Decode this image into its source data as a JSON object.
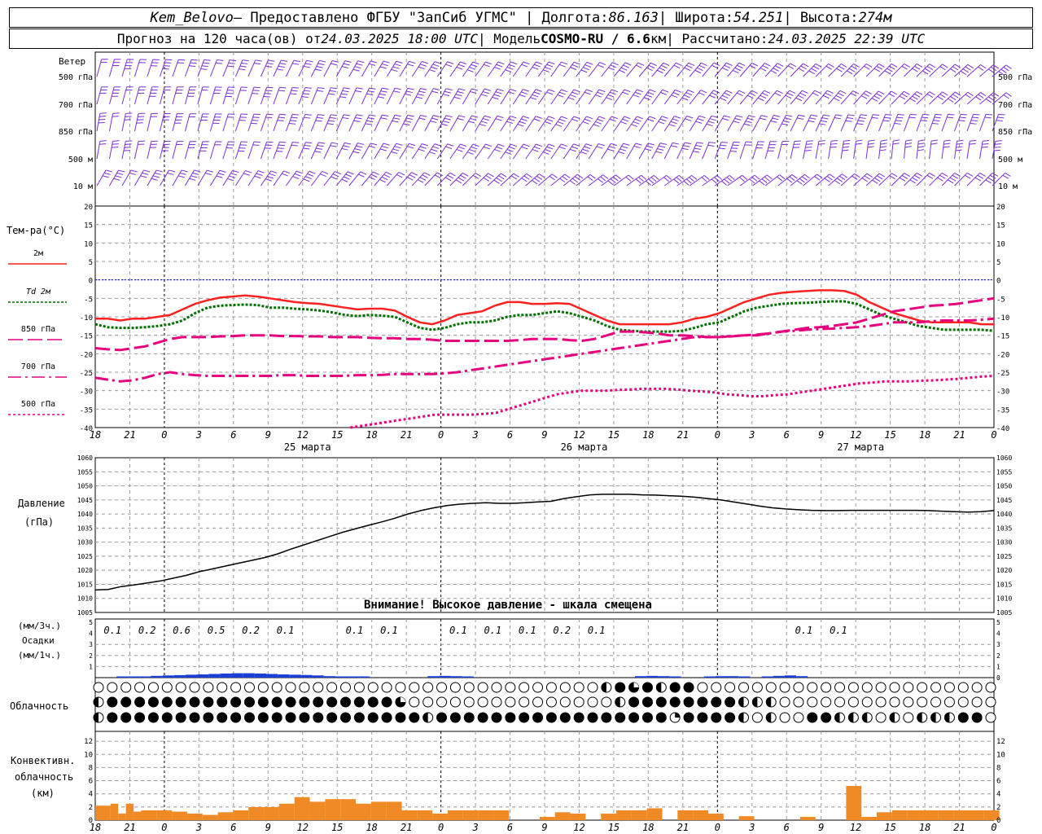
{
  "header": {
    "station": "Kem_Belovo",
    "provider": " – Предоставлено ФГБУ \"ЗапСиб УГМС\" | Долгота: ",
    "lon": "86.163",
    "lat_label": " | Широта: ",
    "lat": "54.251",
    "alt_label": " | Высота: ",
    "alt": "274м",
    "forecast_label": "Прогноз на 120 часа(ов) от ",
    "from": "24.03.2025 18:00 UTC",
    "model_label": " | Модель ",
    "model": "COSMO-RU / 6.6",
    "model_km": "км",
    "calc_label": " | Рассчитано: ",
    "calc": "24.03.2025 22:39 UTC"
  },
  "labels": {
    "wind": "Ветер",
    "wind_levels": [
      "500 гПа",
      "700 гПа",
      "850 гПа",
      "500 м",
      "10 м"
    ],
    "temp_title": "Тем-ра(°C)",
    "temp_legend": [
      "2м",
      "Td 2м",
      "850 гПа",
      "700 гПа",
      "500 гПа"
    ],
    "pressure_title_1": "Давление",
    "pressure_title_2": "(гПа)",
    "pressure_note": "Внимание! Высокое давление - шкала смещена",
    "precip_unit_3h": "(мм/3ч.)",
    "precip_title": "Осадки",
    "precip_unit_1h": "(мм/1ч.)",
    "cloud_title": "Облачность",
    "conv_title_1": "Конвективн.",
    "conv_title_2": "облачность",
    "conv_title_3": "(км)"
  },
  "colors": {
    "wind_barb": "#7b2fd4",
    "t2m": "#ff2020",
    "td2m": "#007000",
    "t850": "#e6007e",
    "t700": "#e6007e",
    "t500": "#e6007e",
    "zero_line": "#0000ff",
    "precip": "#1a3fd6",
    "convective": "#f08a24"
  },
  "chart_data": {
    "type": "line",
    "time_axis": {
      "tick_labels": [
        "18",
        "21",
        "0",
        "3",
        "6",
        "9",
        "12",
        "15",
        "18",
        "21",
        "0",
        "3",
        "6",
        "9",
        "12",
        "15",
        "18",
        "21",
        "0",
        "3",
        "6",
        "9",
        "12",
        "15",
        "18",
        "21",
        "0"
      ],
      "day_labels": [
        "25 марта",
        "26 марта",
        "27 марта"
      ]
    },
    "temperature": {
      "ylim": [
        -40,
        20
      ],
      "yticks": [
        20,
        15,
        10,
        5,
        0,
        -5,
        -10,
        -15,
        -20,
        -25,
        -30,
        -35,
        -40
      ],
      "series": [
        {
          "name": "2м",
          "key": "t2m",
          "values": [
            -10.5,
            -10.5,
            -11,
            -10.5,
            -10.5,
            -10,
            -9.5,
            -8,
            -6.5,
            -5.5,
            -4.8,
            -4.5,
            -4.2,
            -4.5,
            -5,
            -5.5,
            -6,
            -6.3,
            -6.5,
            -7,
            -7.5,
            -8,
            -7.8,
            -7.8,
            -8.3,
            -10,
            -11.5,
            -12,
            -11,
            -9.5,
            -9,
            -8.5,
            -7,
            -6,
            -6,
            -6.5,
            -6.5,
            -6.3,
            -6.5,
            -8,
            -9.5,
            -11,
            -12,
            -12,
            -12,
            -12,
            -12,
            -11.5,
            -10.5,
            -10,
            -9,
            -7.5,
            -6,
            -5,
            -4,
            -3.5,
            -3.2,
            -3,
            -2.8,
            -2.8,
            -3,
            -4,
            -6,
            -7.5,
            -9,
            -10,
            -11,
            -11.5,
            -11.5,
            -11.5,
            -11.5,
            -12,
            -12
          ]
        },
        {
          "name": "Td 2м",
          "key": "td2m",
          "values": [
            -12,
            -12.8,
            -13,
            -13,
            -12.8,
            -12.5,
            -12,
            -11,
            -9,
            -7.5,
            -7,
            -6.8,
            -6.7,
            -6.8,
            -7.5,
            -7.5,
            -7.8,
            -8,
            -8.3,
            -8.8,
            -9.5,
            -9.8,
            -9.5,
            -9.7,
            -10,
            -11.5,
            -13,
            -13.5,
            -13,
            -12,
            -11.5,
            -11.5,
            -11,
            -10,
            -9.5,
            -9.5,
            -9,
            -8.5,
            -9,
            -10,
            -11,
            -12.5,
            -13.5,
            -13.8,
            -14,
            -14,
            -14,
            -13.8,
            -13,
            -12,
            -11.5,
            -10,
            -8.5,
            -7.5,
            -7,
            -6.5,
            -6.3,
            -6.2,
            -6,
            -5.8,
            -5.8,
            -6.5,
            -8,
            -9.5,
            -10.5,
            -11.5,
            -12.5,
            -13,
            -13.5,
            -13.5,
            -13.5,
            -13.5,
            -13.8
          ]
        },
        {
          "name": "850 гПа",
          "key": "t850",
          "dash": "18,6",
          "values": [
            -18.5,
            -18.8,
            -19,
            -18.5,
            -18,
            -17,
            -16,
            -15.5,
            -15.5,
            -15.5,
            -15.3,
            -15.2,
            -15,
            -15,
            -15,
            -15.2,
            -15.2,
            -15.3,
            -15.3,
            -15.5,
            -15.5,
            -15.5,
            -15.7,
            -15.8,
            -15.8,
            -16,
            -16,
            -16.2,
            -16.5,
            -16.5,
            -16.5,
            -16.5,
            -16.5,
            -16.5,
            -16.3,
            -16,
            -16,
            -16,
            -16.3,
            -16.5,
            -16,
            -15,
            -14,
            -14,
            -14.2,
            -14.5,
            -15,
            -15,
            -15.2,
            -15.5,
            -15.5,
            -15.2,
            -15,
            -14.8,
            -14.5,
            -14,
            -13.5,
            -13,
            -12.8,
            -12.5,
            -12,
            -11.5,
            -10.5,
            -9.5,
            -8.5,
            -8,
            -7.5,
            -7,
            -6.8,
            -6.5,
            -6,
            -5.5,
            -5
          ]
        },
        {
          "name": "700 гПа",
          "key": "t700",
          "dash": "16,5,3,5",
          "values": [
            -26.5,
            -27,
            -27.5,
            -27.2,
            -26.5,
            -25.5,
            -25,
            -25.5,
            -25.8,
            -26,
            -26,
            -26,
            -26,
            -26,
            -26,
            -25.8,
            -25.8,
            -26,
            -26,
            -26,
            -26,
            -25.8,
            -25.8,
            -25.7,
            -25.5,
            -25.5,
            -25.5,
            -25.5,
            -25.3,
            -25,
            -24.5,
            -24,
            -23.5,
            -23,
            -22.5,
            -22,
            -21.5,
            -21,
            -20.5,
            -20,
            -19.5,
            -19,
            -18.5,
            -18,
            -17.5,
            -17,
            -16.5,
            -16,
            -15.5,
            -15.5,
            -15.5,
            -15.3,
            -15,
            -15,
            -14.5,
            -14,
            -13.8,
            -13.5,
            -13.3,
            -13.2,
            -13,
            -12.8,
            -12.5,
            -12,
            -11.5,
            -11.5,
            -11.5,
            -11.2,
            -11,
            -11,
            -11,
            -10.8,
            -10.5
          ]
        },
        {
          "name": "500 гПа",
          "key": "t500",
          "dash": "3,3",
          "values": [
            null,
            null,
            null,
            null,
            null,
            null,
            null,
            null,
            null,
            null,
            null,
            null,
            null,
            null,
            null,
            null,
            null,
            null,
            null,
            null,
            null,
            -40,
            -39.5,
            -39,
            -38.5,
            -38,
            -37.5,
            -37,
            -36.5,
            -36.5,
            -36.5,
            -36.5,
            -36.3,
            -36,
            -35,
            -34,
            -33,
            -32,
            -31,
            -30.5,
            -30,
            -30,
            -30,
            -29.8,
            -29.7,
            -29.5,
            -29.5,
            -29.5,
            -29.7,
            -30,
            -30.2,
            -30.5,
            -31,
            -31.2,
            -31.5,
            -31.5,
            -31.2,
            -31,
            -30.5,
            -30,
            -29.5,
            -29,
            -28.5,
            -28,
            -27.8,
            -27.5,
            -27.5,
            -27.5,
            -27.3,
            -27.2,
            -27,
            -26.8,
            -26.5,
            -26.2,
            -26
          ]
        }
      ]
    },
    "pressure": {
      "ylim": [
        1005,
        1060
      ],
      "yticks": [
        1060,
        1055,
        1050,
        1045,
        1040,
        1035,
        1030,
        1025,
        1020,
        1015,
        1010,
        1005
      ],
      "values": [
        1013,
        1013.2,
        1014.2,
        1014.8,
        1015.5,
        1016.2,
        1017.2,
        1018.2,
        1019.5,
        1020.5,
        1021.5,
        1022.5,
        1023.5,
        1024.5,
        1025.8,
        1027.5,
        1029,
        1030.5,
        1032,
        1033.5,
        1034.8,
        1036,
        1037.2,
        1038.5,
        1040,
        1041.2,
        1042.2,
        1043,
        1043.5,
        1043.8,
        1044,
        1043.8,
        1043.8,
        1044,
        1044.3,
        1044.5,
        1045.5,
        1046.2,
        1046.8,
        1047,
        1047,
        1047,
        1046.8,
        1046.7,
        1046.5,
        1046.3,
        1046,
        1045.5,
        1045,
        1044.3,
        1043.6,
        1042.8,
        1042.2,
        1041.8,
        1041.5,
        1041.3,
        1041.2,
        1041.2,
        1041.3,
        1041.3,
        1041.3,
        1041.3,
        1041.3,
        1041.3,
        1041.2,
        1041,
        1040.8,
        1040.7,
        1040.8,
        1041.2
      ]
    },
    "precipitation_3h": {
      "labels": [
        {
          "slot": 0.5,
          "text": "0.1"
        },
        {
          "slot": 1.5,
          "text": "0.2"
        },
        {
          "slot": 2.5,
          "text": "0.6"
        },
        {
          "slot": 3.5,
          "text": "0.5"
        },
        {
          "slot": 4.5,
          "text": "0.2"
        },
        {
          "slot": 5.5,
          "text": "0.1"
        },
        {
          "slot": 7.5,
          "text": "0.1"
        },
        {
          "slot": 8.5,
          "text": "0.1"
        },
        {
          "slot": 10.5,
          "text": "0.1"
        },
        {
          "slot": 11.5,
          "text": "0.1"
        },
        {
          "slot": 12.5,
          "text": "0.1"
        },
        {
          "slot": 13.5,
          "text": "0.2"
        },
        {
          "slot": 14.5,
          "text": "0.1"
        },
        {
          "slot": 20.5,
          "text": "0.1"
        },
        {
          "slot": 21.5,
          "text": "0.1"
        }
      ],
      "left_ticks": [
        5,
        4,
        3,
        2,
        1
      ],
      "right_ticks": [
        5,
        4,
        3,
        2,
        1,
        0
      ],
      "bottom_ticks": [
        2,
        1,
        0
      ],
      "hourly_values": [
        0.01,
        0.02,
        0.08,
        0.12,
        0.15,
        0.17,
        0.2,
        0.22,
        0.25,
        0.28,
        0.3,
        0.3,
        0.28,
        0.25,
        0.22,
        0.2,
        0.18,
        0.15,
        0.1,
        0.08,
        0.06,
        0.03,
        0,
        0,
        0,
        0,
        0,
        0.1,
        0.12,
        0.1,
        0.05,
        0,
        0,
        0,
        0,
        0,
        0,
        0,
        0,
        0,
        0,
        0,
        0,
        0,
        0,
        0.1,
        0.12,
        0.1,
        0.05,
        0,
        0,
        0.08,
        0.1,
        0.1,
        0.08,
        0,
        0.08,
        0.12,
        0.15,
        0.1,
        0,
        0,
        0,
        0,
        0,
        0,
        0,
        0,
        0,
        0,
        0,
        0,
        0,
        0,
        0,
        0,
        0,
        0,
        0,
        0,
        0,
        0,
        0,
        0,
        0,
        0,
        0,
        0,
        0,
        0,
        0,
        0,
        0,
        0,
        0,
        0,
        0,
        0,
        0,
        0,
        0,
        0,
        0,
        0,
        0,
        0,
        0,
        0,
        0,
        0,
        0,
        0,
        0,
        0,
        0,
        0,
        0,
        0,
        0,
        0,
        0,
        0,
        0,
        0,
        0,
        0,
        0,
        0,
        0,
        0,
        0,
        0,
        0
      ]
    },
    "cloudiness": {
      "rows": [
        "oooooooooooooooooooooooooooooooooooooooooooooooooooooooooooooooooooooooooooooooooooooooooooooooooooooooooooooooooooooooo",
        "hhhhhhhhhhhhhhhhhhhhhhhhhhhhhhhhhhhhhhhhhhhhhhhhhhhhhhhhhhhhhhhhhhhhhhhhhhhhhhhhhhhhhhhhhhhhhhhhhhhhhhhhhhhhhhhhhhhhhh"
      ],
      "codes": {
        "row1": "ooooooooooooooooooooooooooooooooooooooooooooooooooooooooooooooooohffftfthhfffqooooooooooooooooooooooooooooooooooooooo",
        "row2": "hfffffffffffffffffffffffffffffffffffffftooooooooooooooooooooooooooohffffffffffffffqhohhoooooooooooooooooooooooooooooo",
        "row3": "hfffffffffffffffffffffffffffffffffffffffffhhfffffffffffffffffffffffffffoffqffffffffhhohhoooffffhfhhhoohooohohhfffffoo"
      }
    },
    "convective": {
      "ylim": [
        0,
        13
      ],
      "yticks": [
        12,
        10,
        8,
        6,
        4,
        2,
        0
      ],
      "segments": [
        {
          "from": 0,
          "to": 1,
          "value": 2.2
        },
        {
          "from": 1,
          "to": 1.5,
          "value": 2.5
        },
        {
          "from": 1.5,
          "to": 2,
          "value": 1.0
        },
        {
          "from": 2,
          "to": 2.5,
          "value": 2.5
        },
        {
          "from": 2.5,
          "to": 3,
          "value": 1.3
        },
        {
          "from": 3,
          "to": 4,
          "value": 1.5
        },
        {
          "from": 4,
          "to": 5,
          "value": 1.5
        },
        {
          "from": 5,
          "to": 6,
          "value": 1.3
        },
        {
          "from": 6,
          "to": 7,
          "value": 1.0
        },
        {
          "from": 7,
          "to": 8,
          "value": 0.8
        },
        {
          "from": 8,
          "to": 9,
          "value": 1.2
        },
        {
          "from": 9,
          "to": 10,
          "value": 1.5
        },
        {
          "from": 10,
          "to": 11,
          "value": 2.0
        },
        {
          "from": 11,
          "to": 12,
          "value": 2.0
        },
        {
          "from": 12,
          "to": 13,
          "value": 2.5
        },
        {
          "from": 13,
          "to": 14,
          "value": 3.5
        },
        {
          "from": 14,
          "to": 15,
          "value": 2.8
        },
        {
          "from": 15,
          "to": 16,
          "value": 3.2
        },
        {
          "from": 16,
          "to": 17,
          "value": 3.2
        },
        {
          "from": 17,
          "to": 18,
          "value": 2.5
        },
        {
          "from": 18,
          "to": 19,
          "value": 2.8
        },
        {
          "from": 19,
          "to": 20,
          "value": 2.8
        },
        {
          "from": 20,
          "to": 21,
          "value": 1.5
        },
        {
          "from": 21,
          "to": 22,
          "value": 1.5
        },
        {
          "from": 22,
          "to": 23,
          "value": 1.0
        },
        {
          "from": 23,
          "to": 24,
          "value": 1.5
        },
        {
          "from": 24,
          "to": 25,
          "value": 1.5
        },
        {
          "from": 25,
          "to": 26,
          "value": 1.5
        },
        {
          "from": 26,
          "to": 27,
          "value": 1.5
        },
        {
          "from": 29,
          "to": 30,
          "value": 0.5
        },
        {
          "from": 30,
          "to": 31,
          "value": 1.2
        },
        {
          "from": 31,
          "to": 32,
          "value": 1.0
        },
        {
          "from": 33,
          "to": 34,
          "value": 1.0
        },
        {
          "from": 34,
          "to": 35,
          "value": 1.5
        },
        {
          "from": 35,
          "to": 36,
          "value": 1.5
        },
        {
          "from": 36,
          "to": 37,
          "value": 1.8
        },
        {
          "from": 38,
          "to": 39,
          "value": 1.5
        },
        {
          "from": 39,
          "to": 40,
          "value": 1.5
        },
        {
          "from": 40,
          "to": 41,
          "value": 1.0
        },
        {
          "from": 42,
          "to": 43,
          "value": 0.6
        },
        {
          "from": 46,
          "to": 47,
          "value": 0.5
        },
        {
          "from": 49,
          "to": 50,
          "value": 5.2
        },
        {
          "from": 50,
          "to": 51,
          "value": 0.5
        },
        {
          "from": 51,
          "to": 52,
          "value": 1.2
        },
        {
          "from": 52,
          "to": 53,
          "value": 1.5
        },
        {
          "from": 53,
          "to": 54,
          "value": 1.5
        },
        {
          "from": 54,
          "to": 55,
          "value": 1.5
        },
        {
          "from": 55,
          "to": 56,
          "value": 1.5
        },
        {
          "from": 56,
          "to": 57,
          "value": 1.5
        },
        {
          "from": 57,
          "to": 58,
          "value": 1.5
        },
        {
          "from": 58,
          "to": 59,
          "value": 1.5
        }
      ]
    },
    "wind": {
      "levels_count": 5,
      "barbs_per_level": 72
    }
  }
}
